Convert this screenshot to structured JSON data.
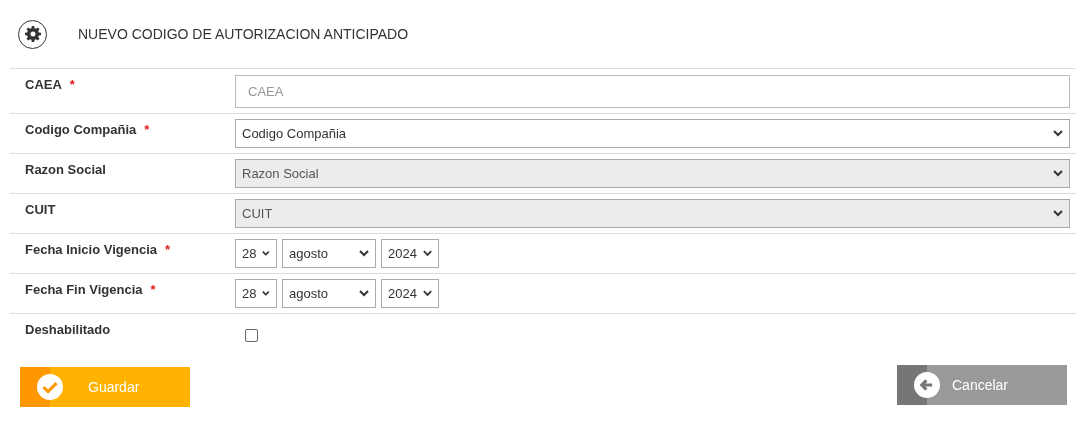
{
  "header": {
    "title": "NUEVO CODIGO DE AUTORIZACION ANTICIPADO"
  },
  "fields": [
    {
      "kind": "text",
      "label": "CAEA",
      "required_mark": "*",
      "placeholder": "CAEA"
    },
    {
      "kind": "select",
      "label": "Codigo Compañia",
      "required_mark": "*",
      "value": "Codigo Compañia",
      "disabled": false
    },
    {
      "kind": "select",
      "label": "Razon Social",
      "value": "Razon Social",
      "disabled": true
    },
    {
      "kind": "select",
      "label": "CUIT",
      "value": "CUIT",
      "disabled": true
    },
    {
      "kind": "date",
      "label": "Fecha Inicio Vigencia",
      "required_mark": "*",
      "day": "28",
      "month": "agosto",
      "year": "2024"
    },
    {
      "kind": "date",
      "label": "Fecha Fin Vigencia",
      "required_mark": "*",
      "day": "28",
      "month": "agosto",
      "year": "2024"
    },
    {
      "kind": "checkbox",
      "label": "Deshabilitado",
      "checked": false
    }
  ],
  "buttons": [
    {
      "kind": "save",
      "label": "Guardar"
    },
    {
      "kind": "cancel",
      "label": "Cancelar"
    }
  ]
}
